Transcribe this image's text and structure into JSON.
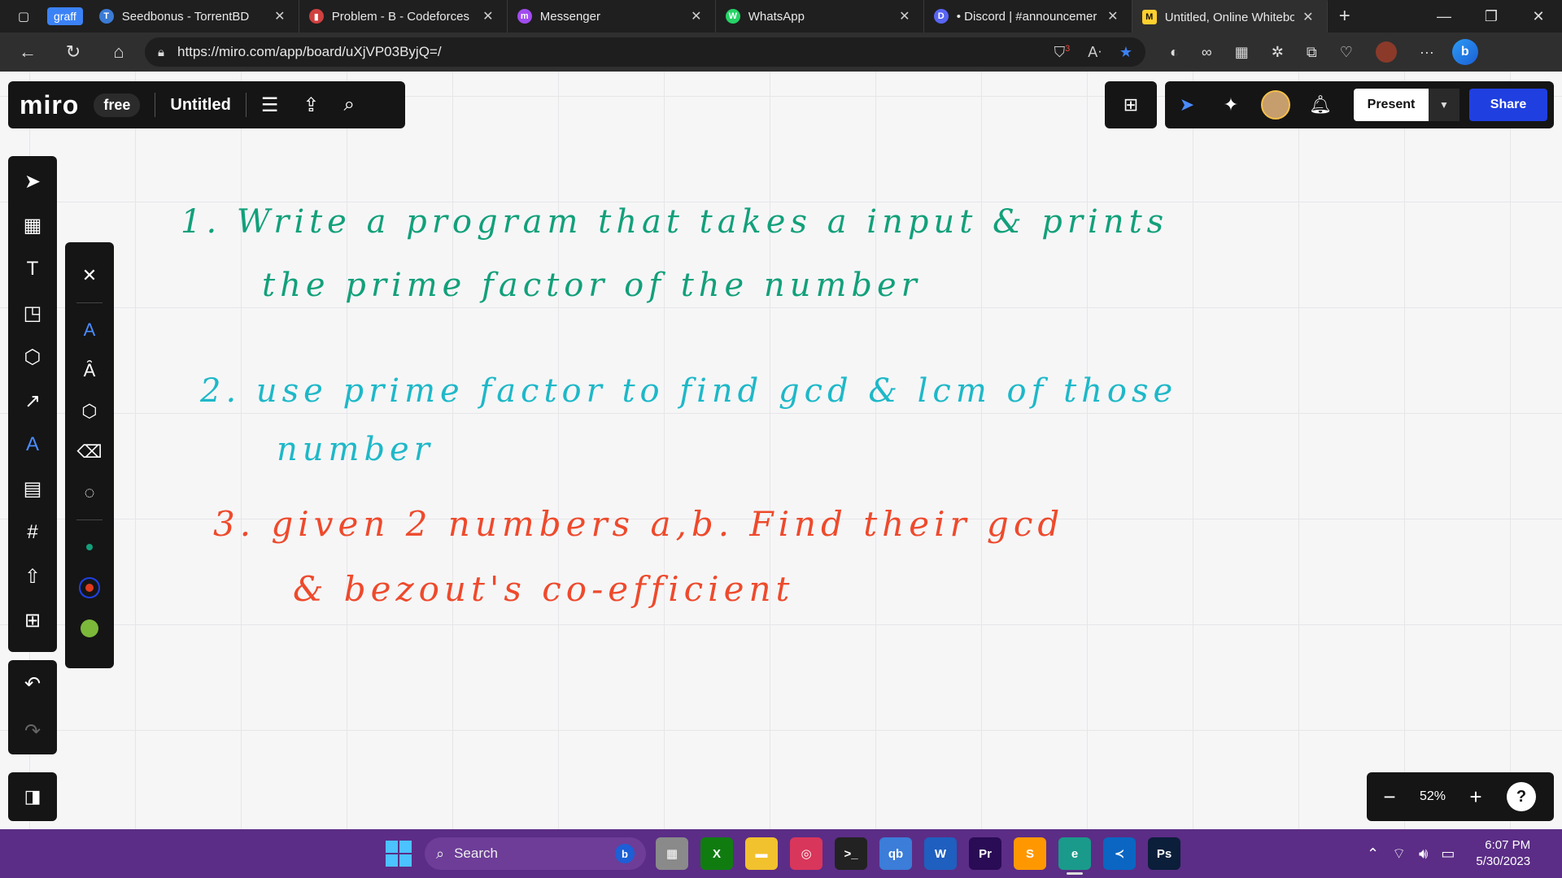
{
  "browser": {
    "group_label": "graff",
    "tabs": [
      {
        "title": "Seedbonus - TorrentBD",
        "fav_color": "#3a7bd5",
        "fav_glyph": "T"
      },
      {
        "title": "Problem - B - Codeforces",
        "fav_color": "#d04040",
        "fav_glyph": "▮"
      },
      {
        "title": "Messenger",
        "fav_color": "#a24cf0",
        "fav_glyph": "m"
      },
      {
        "title": "WhatsApp",
        "fav_color": "#25d366",
        "fav_glyph": "W"
      },
      {
        "title": "• Discord | #announcemer",
        "fav_color": "#5865f2",
        "fav_glyph": "D"
      },
      {
        "title": "Untitled, Online Whiteboa",
        "fav_color": "#ffd02f",
        "fav_glyph": "M"
      }
    ],
    "url": "https://miro.com/app/board/uXjVP03ByjQ=/",
    "badge_count": "3"
  },
  "miro": {
    "logo": "miro",
    "plan": "free",
    "board_title": "Untitled",
    "present_label": "Present",
    "share_label": "Share",
    "zoom": "52%",
    "help": "?"
  },
  "notes": {
    "line1a": "1. Write a program that takes a input & prints",
    "line1b": "the prime factor of the number",
    "line2a": "2. use prime factor to find gcd & lcm of those",
    "line2b": "number",
    "line3a": "3. given 2 numbers a,b. Find their gcd",
    "line3b": "& bezout's co-efficient"
  },
  "taskbar": {
    "search_label": "Search",
    "time": "6:07 PM",
    "date": "5/30/2023",
    "apps": [
      {
        "name": "files-app",
        "color": "#8a8a8a",
        "glyph": "▦"
      },
      {
        "name": "xbox-app",
        "color": "#107c10",
        "glyph": "X"
      },
      {
        "name": "file-explorer",
        "color": "#f2c12e",
        "glyph": "▬"
      },
      {
        "name": "app-red",
        "color": "#d9365b",
        "glyph": "◎"
      },
      {
        "name": "terminal-app",
        "color": "#222222",
        "glyph": ">_"
      },
      {
        "name": "qbittorrent-app",
        "color": "#3b7dd8",
        "glyph": "qb"
      },
      {
        "name": "app-w",
        "color": "#1f5fbf",
        "glyph": "W"
      },
      {
        "name": "premiere-app",
        "color": "#2a0b55",
        "glyph": "Pr"
      },
      {
        "name": "sublime-app",
        "color": "#ff9800",
        "glyph": "S"
      },
      {
        "name": "edge-app",
        "color": "#1a9a8a",
        "glyph": "e"
      },
      {
        "name": "vscode-app",
        "color": "#0a66c2",
        "glyph": "≺"
      },
      {
        "name": "photoshop-app",
        "color": "#0b1e3a",
        "glyph": "Ps"
      }
    ]
  },
  "colors": {
    "ink_green": "#12a07a",
    "ink_cyan": "#1eb8c8",
    "ink_red": "#ee4a2c",
    "accent_share": "#1f3fe0"
  }
}
